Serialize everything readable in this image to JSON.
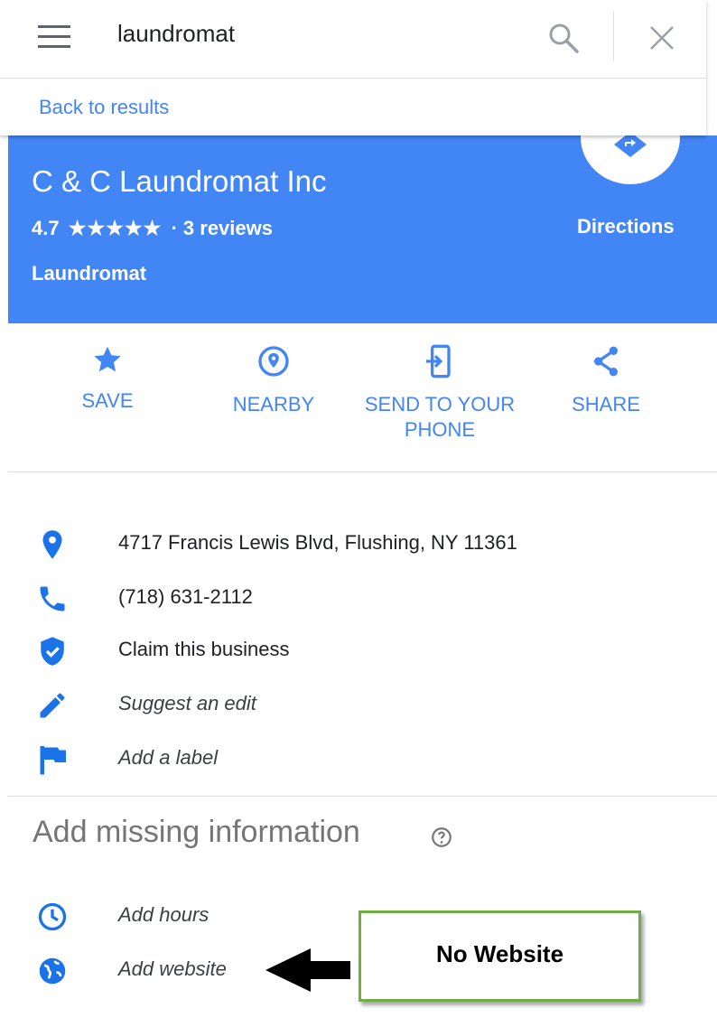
{
  "search": {
    "query": "laundromat",
    "back_label": "Back to results"
  },
  "place": {
    "name": "C & C Laundromat Inc",
    "rating": "4.7",
    "stars": "★★★★★",
    "reviews": "· 3 reviews",
    "category": "Laundromat",
    "directions_label": "Directions"
  },
  "actions": [
    {
      "label": "SAVE",
      "icon": "star-icon"
    },
    {
      "label": "NEARBY",
      "icon": "nearby-icon"
    },
    {
      "label": "SEND TO YOUR PHONE",
      "icon": "send-to-phone-icon"
    },
    {
      "label": "SHARE",
      "icon": "share-icon"
    }
  ],
  "info": {
    "address": "4717 Francis Lewis Blvd, Flushing, NY 11361",
    "phone": "(718) 631-2112",
    "claim": "Claim this business",
    "suggest_edit": "Suggest an edit",
    "add_label": "Add a label"
  },
  "missing": {
    "title": "Add missing information",
    "add_hours": "Add hours",
    "add_website": "Add website"
  },
  "annotation": {
    "callout": "No Website"
  },
  "colors": {
    "brand_blue": "#4285f4",
    "callout_border": "#70ad47"
  }
}
